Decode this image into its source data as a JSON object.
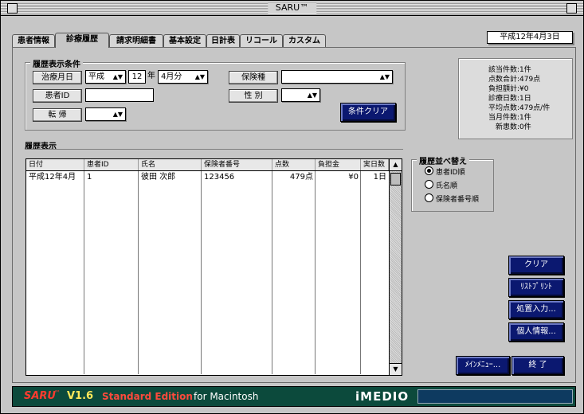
{
  "window": {
    "title": "SARU™"
  },
  "tabs": [
    {
      "label": "患者情報"
    },
    {
      "label": "診療履歴"
    },
    {
      "label": "請求明細書"
    },
    {
      "label": "基本設定"
    },
    {
      "label": "日計表"
    },
    {
      "label": "リコール"
    },
    {
      "label": "カスタム"
    }
  ],
  "date": "平成12年4月3日",
  "filter": {
    "title": "履歴表示条件",
    "treatment_month_btn": "治療月日",
    "era_select": "平成",
    "year_value": "12",
    "year_label": "年",
    "month_select": "4月分",
    "insurance_type_btn": "保険種",
    "insurance_type_select": "",
    "patient_id_btn": "患者ID",
    "patient_id_value": "",
    "gender_btn": "性 別",
    "gender_select": "",
    "outcome_btn": "転 帰",
    "outcome_select": "",
    "clear_btn": "条件クリア"
  },
  "summary": [
    {
      "key": "該当件数",
      "value": "1件"
    },
    {
      "key": "点数合計",
      "value": "479点"
    },
    {
      "key": "負担額計",
      "value": "¥0"
    },
    {
      "key": "診療日数",
      "value": "1日"
    },
    {
      "key": "平均点数",
      "value": "479点/件"
    },
    {
      "key": "当月件数",
      "value": "1件"
    },
    {
      "key": "新患数",
      "value": "0件"
    }
  ],
  "history": {
    "title": "履歴表示",
    "columns": [
      "日付",
      "患者ID",
      "氏名",
      "保険者番号",
      "点数",
      "負担金",
      "実日数"
    ],
    "rows": [
      [
        "平成12年4月",
        "1",
        "彼田 次郎",
        "123456",
        "479点",
        "¥0",
        "1日"
      ]
    ]
  },
  "sort": {
    "title": "履歴並べ替え",
    "options": [
      {
        "label": "患者ID順",
        "selected": true
      },
      {
        "label": "氏名順",
        "selected": false
      },
      {
        "label": "保険者番号順",
        "selected": false
      }
    ]
  },
  "actions": {
    "clear": "クリア",
    "list_print": "ﾘｽﾄﾌﾟﾘﾝﾄ",
    "prescription": "処置入力...",
    "personal": "個人情報...",
    "main_menu": "ﾒｲﾝﾒﾆｭｰ...",
    "exit": "終 了"
  },
  "footer": {
    "brand": "SARU",
    "tm": "™",
    "version": "V1.6",
    "edition": "Standard Edition",
    "platform": "for Macintosh",
    "logo": "iMEDIO"
  },
  "colors": {
    "navy": "#0b1870",
    "footer_bg": "#0c4a3c",
    "brand_red": "#ff3b2f",
    "version_yellow": "#ffe85a"
  }
}
